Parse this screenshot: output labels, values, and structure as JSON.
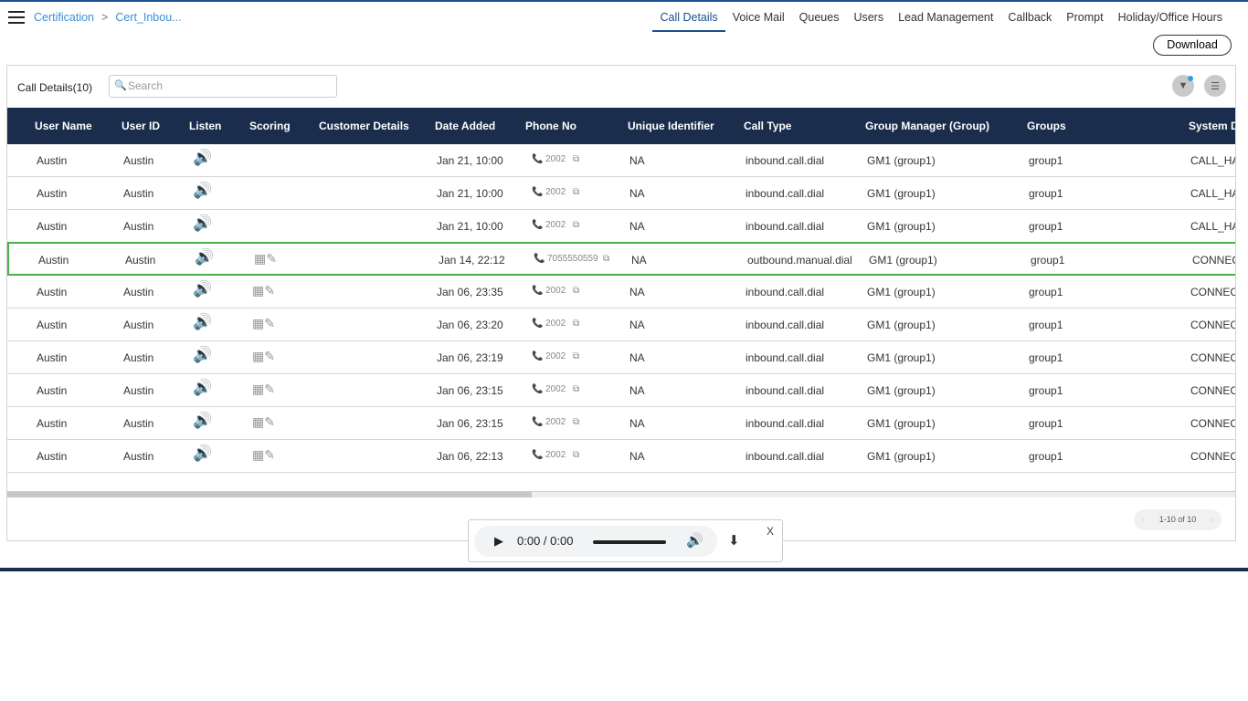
{
  "breadcrumb": [
    "Certification",
    "Cert_Inbou..."
  ],
  "tabs": [
    "Call Details",
    "Voice Mail",
    "Queues",
    "Users",
    "Lead Management",
    "Callback",
    "Prompt",
    "Holiday/Office Hours"
  ],
  "active_tab": "Call Details",
  "download_label": "Download",
  "table_title": "Call Details(10)",
  "search_placeholder": "Search",
  "columns": [
    "User Name",
    "User ID",
    "Listen",
    "Scoring",
    "Customer Details",
    "Date Added",
    "Phone No",
    "Unique Identifier",
    "Call Type",
    "Group Manager (Group)",
    "Groups",
    "System D"
  ],
  "rows": [
    {
      "user": "Austin",
      "id": "Austin",
      "listen_enabled": false,
      "scoring": false,
      "date": "Jan 21, 10:00",
      "phone": "2002",
      "uid": "NA",
      "type": "inbound.call.dial",
      "gm": "GM1 (group1)",
      "group": "group1",
      "system": "CALL_HA"
    },
    {
      "user": "Austin",
      "id": "Austin",
      "listen_enabled": false,
      "scoring": false,
      "date": "Jan 21, 10:00",
      "phone": "2002",
      "uid": "NA",
      "type": "inbound.call.dial",
      "gm": "GM1 (group1)",
      "group": "group1",
      "system": "CALL_HA"
    },
    {
      "user": "Austin",
      "id": "Austin",
      "listen_enabled": false,
      "scoring": false,
      "date": "Jan 21, 10:00",
      "phone": "2002",
      "uid": "NA",
      "type": "inbound.call.dial",
      "gm": "GM1 (group1)",
      "group": "group1",
      "system": "CALL_HA"
    },
    {
      "user": "Austin",
      "id": "Austin",
      "listen_enabled": true,
      "scoring": true,
      "selected": true,
      "date": "Jan 14, 22:12",
      "phone": "7055550559",
      "uid": "NA",
      "type": "outbound.manual.dial",
      "gm": "GM1 (group1)",
      "group": "group1",
      "system": "CONNECT"
    },
    {
      "user": "Austin",
      "id": "Austin",
      "listen_enabled": true,
      "scoring": true,
      "date": "Jan 06, 23:35",
      "phone": "2002",
      "uid": "NA",
      "type": "inbound.call.dial",
      "gm": "GM1 (group1)",
      "group": "group1",
      "system": "CONNECT"
    },
    {
      "user": "Austin",
      "id": "Austin",
      "listen_enabled": true,
      "scoring": true,
      "date": "Jan 06, 23:20",
      "phone": "2002",
      "uid": "NA",
      "type": "inbound.call.dial",
      "gm": "GM1 (group1)",
      "group": "group1",
      "system": "CONNECT"
    },
    {
      "user": "Austin",
      "id": "Austin",
      "listen_enabled": true,
      "scoring": true,
      "date": "Jan 06, 23:19",
      "phone": "2002",
      "uid": "NA",
      "type": "inbound.call.dial",
      "gm": "GM1 (group1)",
      "group": "group1",
      "system": "CONNECT"
    },
    {
      "user": "Austin",
      "id": "Austin",
      "listen_enabled": true,
      "scoring": true,
      "date": "Jan 06, 23:15",
      "phone": "2002",
      "uid": "NA",
      "type": "inbound.call.dial",
      "gm": "GM1 (group1)",
      "group": "group1",
      "system": "CONNECT"
    },
    {
      "user": "Austin",
      "id": "Austin",
      "listen_enabled": true,
      "scoring": true,
      "date": "Jan 06, 23:15",
      "phone": "2002",
      "uid": "NA",
      "type": "inbound.call.dial",
      "gm": "GM1 (group1)",
      "group": "group1",
      "system": "CONNECT"
    },
    {
      "user": "Austin",
      "id": "Austin",
      "listen_enabled": true,
      "scoring": true,
      "date": "Jan 06, 22:13",
      "phone": "2002",
      "uid": "NA",
      "type": "inbound.call.dial",
      "gm": "GM1 (group1)",
      "group": "group1",
      "system": "CONNECT"
    }
  ],
  "pagination": "1-10 of 10",
  "player": {
    "time": "0:00 / 0:00",
    "close": "X"
  },
  "colors": {
    "header": "#1b2d4d",
    "accent": "#1a4f8f",
    "link": "#3a8fd6",
    "selected_border": "#4cae4c"
  }
}
